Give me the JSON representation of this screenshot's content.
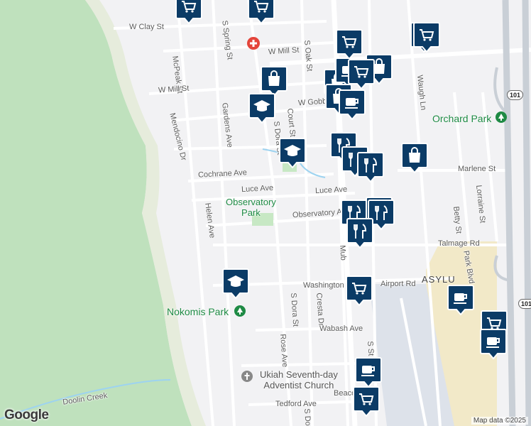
{
  "streets": [
    {
      "id": "w-clay-st",
      "text": "W Clay St"
    },
    {
      "id": "mcpeak-st",
      "text": "McPeak St"
    },
    {
      "id": "s-spring-st",
      "text": "S Spring St"
    },
    {
      "id": "w-mill-st-east",
      "text": "W Mill St"
    },
    {
      "id": "w-mill-st-west",
      "text": "W Mill St"
    },
    {
      "id": "s-oak-st",
      "text": "S Oak St"
    },
    {
      "id": "gardens-ave",
      "text": "Gardens Ave"
    },
    {
      "id": "mendocino-dr",
      "text": "Mendocino Dr"
    },
    {
      "id": "w-gobbi",
      "text": "W Gobbi"
    },
    {
      "id": "court-st",
      "text": "Court St"
    },
    {
      "id": "s-dora-st-north",
      "text": "S Dora St"
    },
    {
      "id": "cochrane-ave",
      "text": "Cochrane Ave"
    },
    {
      "id": "luce-ave-west",
      "text": "Luce Ave"
    },
    {
      "id": "luce-ave-east",
      "text": "Luce Ave"
    },
    {
      "id": "helen-ave",
      "text": "Helen Ave"
    },
    {
      "id": "observatory-ave",
      "text": "Observatory A"
    },
    {
      "id": "waugh-ln",
      "text": "Waugh Ln"
    },
    {
      "id": "marlene-st",
      "text": "Marlene St"
    },
    {
      "id": "lorraine-st",
      "text": "Lorraine St"
    },
    {
      "id": "betty-st",
      "text": "Betty St"
    },
    {
      "id": "talmage-rd",
      "text": "Talmage Rd"
    },
    {
      "id": "park-blvd",
      "text": "Park Blvd"
    },
    {
      "id": "washington",
      "text": "Washington"
    },
    {
      "id": "airport-rd",
      "text": "Airport Rd"
    },
    {
      "id": "s-dora-st-south",
      "text": "S Dora St"
    },
    {
      "id": "cresta-dr",
      "text": "Cresta Dr"
    },
    {
      "id": "wabash-ave",
      "text": "Wabash Ave"
    },
    {
      "id": "rose-ave",
      "text": "Rose Ave"
    },
    {
      "id": "doolin-creek",
      "text": "Doolin Creek"
    },
    {
      "id": "beacon",
      "text": "Beaco"
    },
    {
      "id": "tedford-ave",
      "text": "Tedford Ave"
    },
    {
      "id": "s-do",
      "text": "S Do"
    },
    {
      "id": "s-st",
      "text": "S St"
    },
    {
      "id": "muk",
      "text": "Mub"
    },
    {
      "id": "asylum",
      "text": "ASYLU"
    }
  ],
  "places": {
    "observatory_park_line1": "Observatory",
    "observatory_park_line2": "Park",
    "nokomis_park": "Nokomis Park",
    "orchard_park": "Orchard Park",
    "church_line1": "Ukiah Seventh-day",
    "church_line2": "Adventist Church"
  },
  "highway": {
    "number": "101"
  },
  "attribution": "Map data ©2025",
  "logo": "Google",
  "colors": {
    "pin": "#0b3b66",
    "pin_border": "#ffffff",
    "park_green": "#c7e8c4",
    "park_text": "#1e8a44",
    "church_text": "#555555",
    "hospital_red": "#e4453b",
    "water": "#9dd3f0",
    "highway": "#c9cfd6"
  },
  "pins": [
    {
      "icon": "cart-icon"
    },
    {
      "icon": "cart-icon"
    },
    {
      "icon": "coffee-icon"
    },
    {
      "icon": "bag-icon"
    },
    {
      "icon": "cart-icon"
    },
    {
      "icon": "bag-icon"
    },
    {
      "icon": "bag-icon"
    },
    {
      "icon": "graduation-cap-icon"
    },
    {
      "icon": "coffee-icon"
    },
    {
      "icon": "bag-icon"
    },
    {
      "icon": "coffee-icon"
    },
    {
      "icon": "cart-icon"
    },
    {
      "icon": "graduation-cap-icon"
    },
    {
      "icon": "fork-knife-icon"
    },
    {
      "icon": "fork-knife-icon"
    },
    {
      "icon": "fork-knife-icon"
    },
    {
      "icon": "bag-icon"
    },
    {
      "icon": "fork-knife-icon"
    },
    {
      "icon": "fork-knife-icon"
    },
    {
      "icon": "fork-knife-icon"
    },
    {
      "icon": "fork-knife-icon"
    },
    {
      "icon": "graduation-cap-icon"
    },
    {
      "icon": "cart-icon"
    },
    {
      "icon": "cart-icon"
    },
    {
      "icon": "coffee-icon"
    },
    {
      "icon": "coffee-icon"
    },
    {
      "icon": "cart-icon"
    },
    {
      "icon": "coffee-icon"
    },
    {
      "icon": "cart-icon"
    }
  ]
}
